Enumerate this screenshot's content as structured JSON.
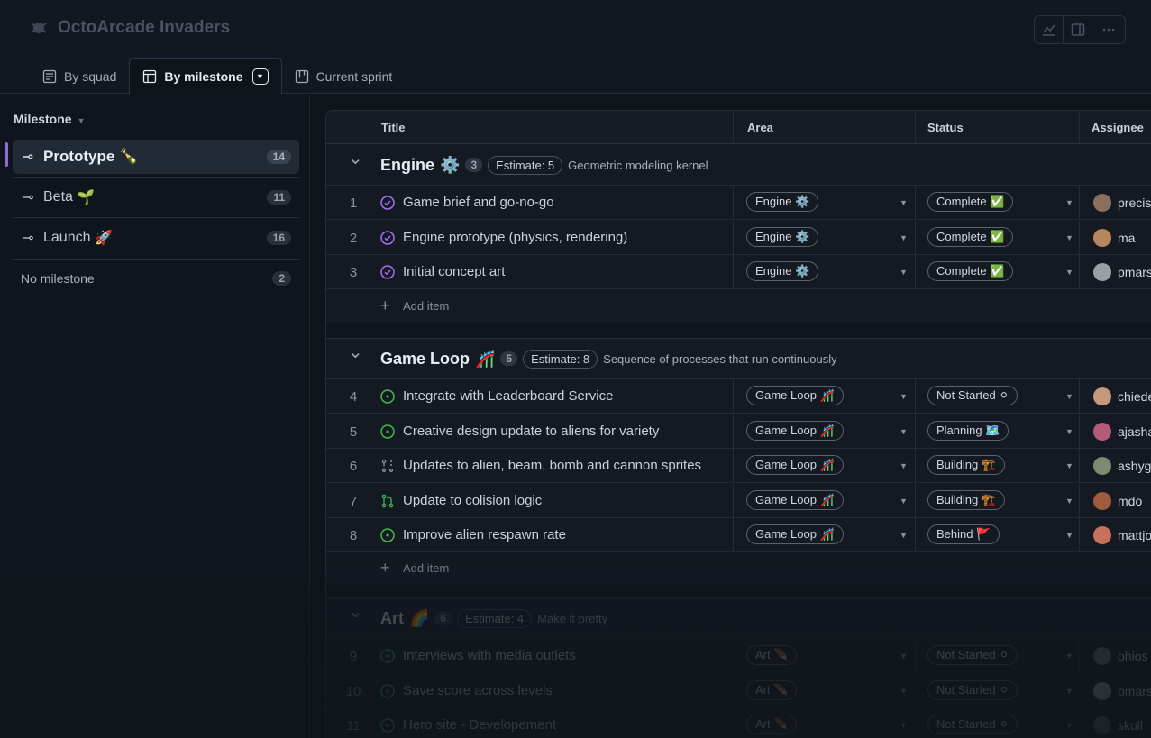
{
  "app": {
    "title": "OctoArcade Invaders"
  },
  "tabs": [
    {
      "label": "By squad",
      "icon": "table-list-icon"
    },
    {
      "label": "By milestone",
      "icon": "table-icon"
    },
    {
      "label": "Current sprint",
      "icon": "board-icon"
    }
  ],
  "sidebar": {
    "header": "Milestone",
    "milestones": [
      {
        "label": "Prototype",
        "emoji": "🍾",
        "count": "14"
      },
      {
        "label": "Beta",
        "emoji": "🌱",
        "count": "11"
      },
      {
        "label": "Launch",
        "emoji": "🚀",
        "count": "16"
      }
    ],
    "no_milestone": {
      "label": "No milestone",
      "count": "2"
    }
  },
  "table": {
    "columns": {
      "title": "Title",
      "area": "Area",
      "status": "Status",
      "assignee": "Assignee"
    },
    "add_item": "Add item",
    "groups": [
      {
        "name": "Engine",
        "emoji": "⚙️",
        "count": "3",
        "estimate": "Estimate: 5",
        "desc": "Geometric modeling kernel"
      },
      {
        "name": "Game Loop",
        "emoji": "🎢",
        "count": "5",
        "estimate": "Estimate: 8",
        "desc": "Sequence of processes that run continuously"
      },
      {
        "name": "Art",
        "emoji": "🌈",
        "count": "6",
        "estimate": "Estimate: 4",
        "desc": "Make it pretty"
      }
    ],
    "rows": [
      {
        "num": "1",
        "title": "Game brief and go-no-go",
        "area": "Engine ⚙️",
        "status": "Complete ✅",
        "assignee": "precis",
        "icon": "done-circle-icon",
        "avatar": "#8a6f5e"
      },
      {
        "num": "2",
        "title": "Engine prototype (physics, rendering)",
        "area": "Engine ⚙️",
        "status": "Complete ✅",
        "assignee": "ma",
        "icon": "done-circle-icon",
        "avatar": "#b8865c"
      },
      {
        "num": "3",
        "title": "Initial concept art",
        "area": "Engine ⚙️",
        "status": "Complete ✅",
        "assignee": "pmars",
        "icon": "done-circle-icon",
        "avatar": "#9aa0a6"
      },
      {
        "num": "4",
        "title": "Integrate with Leaderboard Service",
        "area": "Game Loop 🎢",
        "status": "Not Started ⚪",
        "assignee": "chiede",
        "icon": "open-circle-icon",
        "avatar": "#c49a7a"
      },
      {
        "num": "5",
        "title": "Creative design update to aliens for variety",
        "area": "Game Loop 🎢",
        "status": "Planning 🗺️",
        "assignee": "ajasha",
        "icon": "open-circle-icon",
        "avatar": "#b35b7a"
      },
      {
        "num": "6",
        "title": "Updates to alien, beam, bomb and cannon sprites",
        "area": "Game Loop 🎢",
        "status": "Building 🏗️",
        "assignee": "ashyg",
        "icon": "draft-pr-icon",
        "avatar": "#7f8a72"
      },
      {
        "num": "7",
        "title": "Update to colision logic",
        "area": "Game Loop 🎢",
        "status": "Building 🏗️",
        "assignee": "mdo",
        "icon": "pull-request-icon",
        "avatar": "#a05a3c"
      },
      {
        "num": "8",
        "title": "Improve alien respawn rate",
        "area": "Game Loop 🎢",
        "status": "Behind 🚩",
        "assignee": "mattjo",
        "icon": "open-circle-icon",
        "avatar": "#c7705c"
      },
      {
        "num": "9",
        "title": "Interviews with media outlets",
        "area": "Art 🪶",
        "status": "Not Started ⚪",
        "assignee": "ohios",
        "icon": "open-circle-icon",
        "avatar": "#6e7781"
      },
      {
        "num": "10",
        "title": "Save score across levels",
        "area": "Art 🪶",
        "status": "Not Started ⚪",
        "assignee": "pmars",
        "icon": "open-circle-icon",
        "avatar": "#9aa0a6"
      },
      {
        "num": "11",
        "title": "Hero site - Developement",
        "area": "Art 🪶",
        "status": "Not Started ⚪",
        "assignee": "skull",
        "icon": "open-circle-icon",
        "avatar": "#5a616b"
      }
    ]
  }
}
